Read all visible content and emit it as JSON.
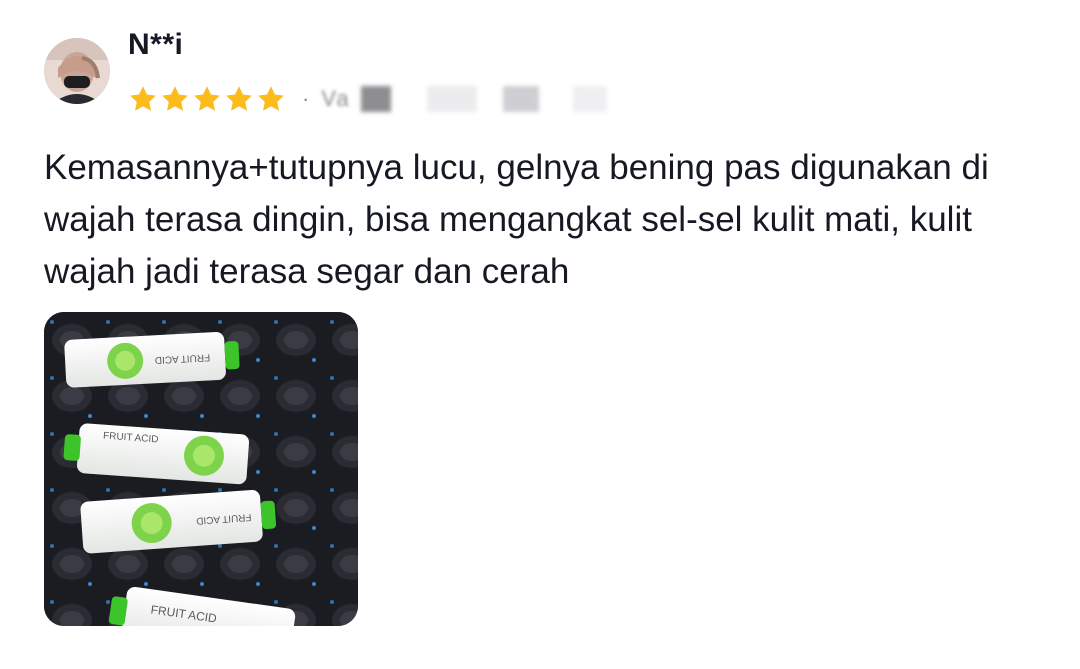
{
  "review": {
    "username": "N**i",
    "rating": 5,
    "rating_max": 5,
    "separator": "·",
    "variant": "Va",
    "comment": "Kemasannya+tutupnya lucu, gelnya bening pas digunakan di wajah terasa dingin, bisa mengangkat sel-sel kulit mati, kulit wajah jadi terasa segar dan cerah",
    "photo": {
      "label_text": "FRUIT ACID",
      "tube_count": 4
    }
  },
  "colors": {
    "star": "#fdbb1d",
    "text": "#161823",
    "muted": "#8a8b91",
    "tube_cap": "#3dc42a",
    "photo_bg": "#1b1c22"
  },
  "icons": {
    "star": "star-icon",
    "avatar": "avatar-image"
  }
}
